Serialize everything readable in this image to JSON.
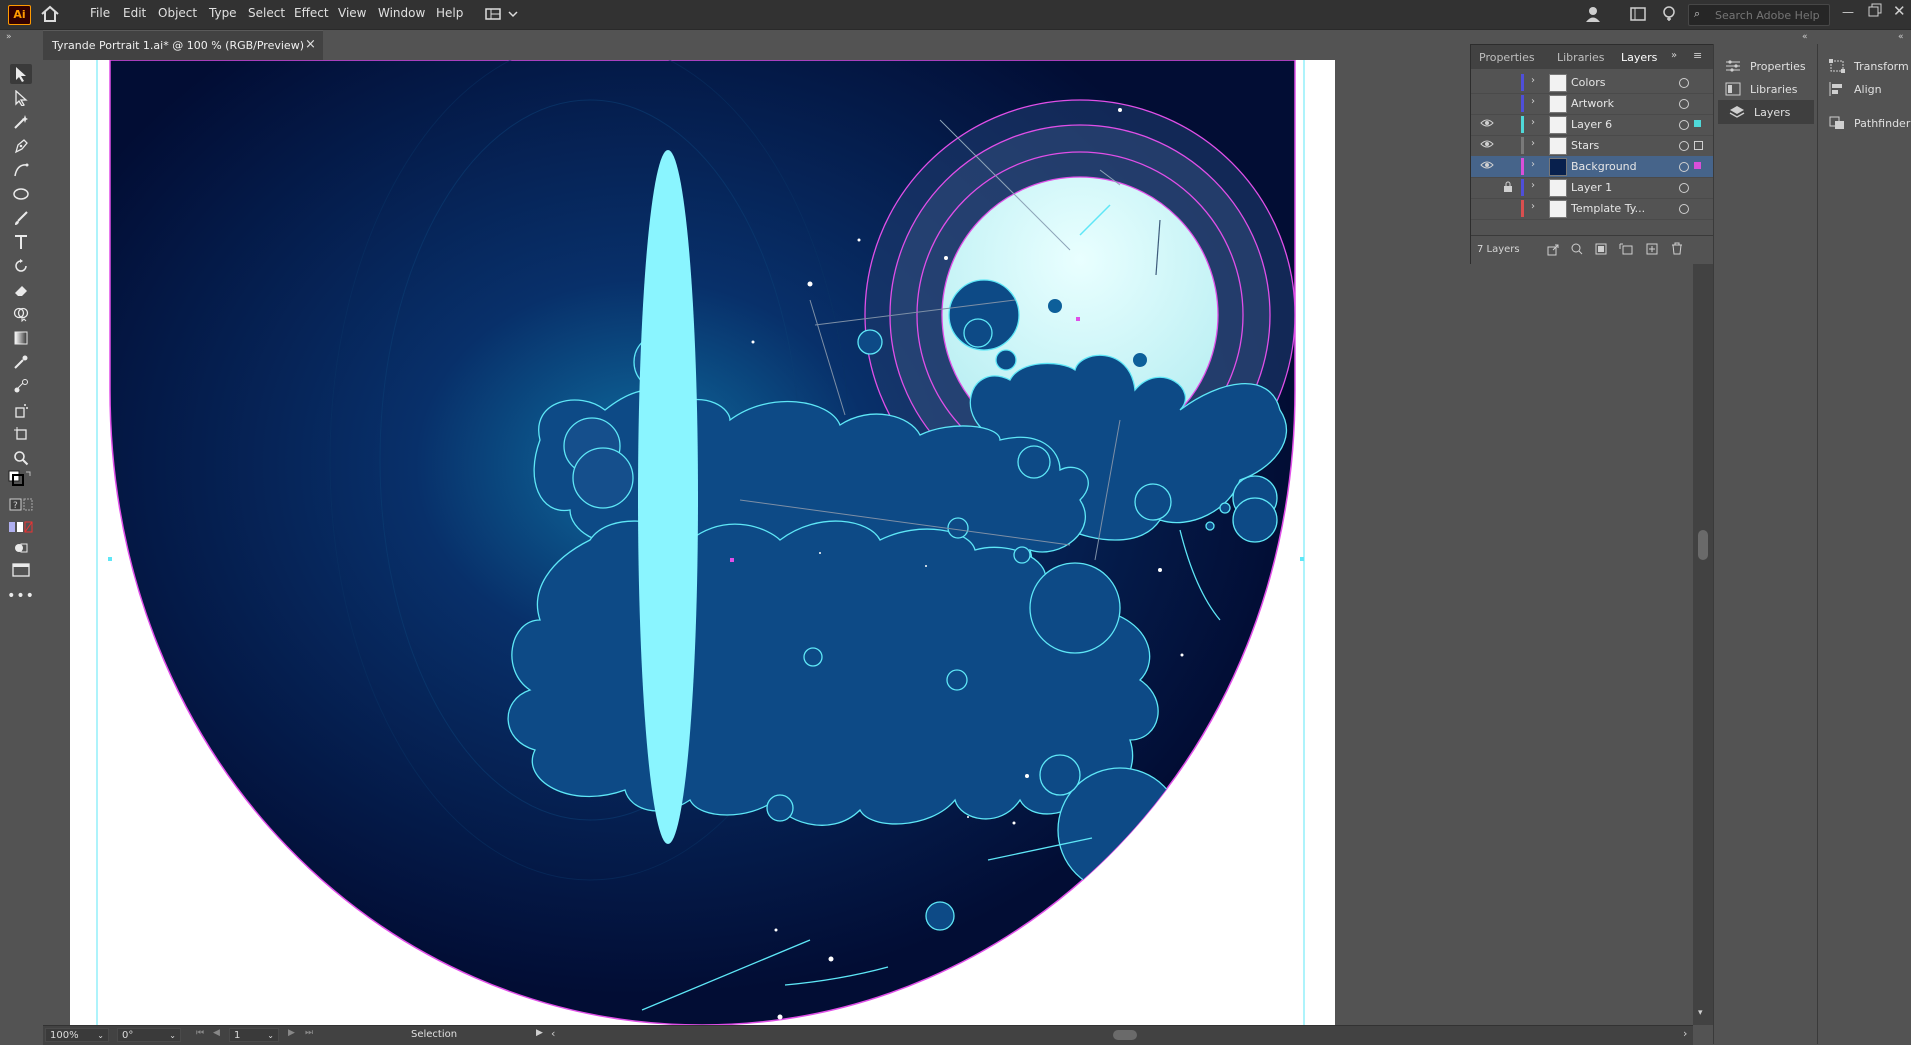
{
  "app": {
    "logo": "Ai",
    "menu": [
      "File",
      "Edit",
      "Object",
      "Type",
      "Select",
      "Effect",
      "View",
      "Window",
      "Help"
    ],
    "search_placeholder": "Search Adobe Help"
  },
  "document": {
    "tab_title": "Tyrande Portrait 1.ai* @ 100 % (RGB/Preview)",
    "close_glyph": "×"
  },
  "layers_panel": {
    "tabs": [
      "Properties",
      "Libraries",
      "Layers"
    ],
    "active_tab": "Layers",
    "layers": [
      {
        "name": "Colors",
        "visible": false,
        "locked": false,
        "color": "#4f4fd9",
        "selected": false
      },
      {
        "name": "Artwork",
        "visible": false,
        "locked": false,
        "color": "#4f4fd9",
        "selected": false
      },
      {
        "name": "Layer 6",
        "visible": true,
        "locked": false,
        "color": "#4fd9d9",
        "selected": false
      },
      {
        "name": "Stars",
        "visible": true,
        "locked": false,
        "color": "#7a7a7a",
        "selected": false
      },
      {
        "name": "Background",
        "visible": true,
        "locked": false,
        "color": "#d94fd9",
        "selected": true
      },
      {
        "name": "Layer 1",
        "visible": false,
        "locked": true,
        "color": "#4f4fd9",
        "selected": false
      },
      {
        "name": "Template Ty...",
        "visible": false,
        "locked": false,
        "color": "#d94f4f",
        "selected": false
      }
    ],
    "count_label": "7 Layers"
  },
  "dock": {
    "col1": [
      "Properties",
      "Libraries",
      "Layers"
    ],
    "col2": [
      "Transform",
      "Align",
      "Pathfinder"
    ]
  },
  "status": {
    "zoom": "100%",
    "rotation": "0°",
    "artboard_num": "1",
    "tool_name": "Selection"
  },
  "colors": {
    "menubar": "#323232",
    "ui_bg": "#535353",
    "sky_dark": "#03103a",
    "cloud": "#0d4a86",
    "cyan_stroke": "#5ee7f7",
    "magenta_stroke": "#e04fe8",
    "moon": "#d9fbfb",
    "light_beam": "#8af5ff"
  }
}
